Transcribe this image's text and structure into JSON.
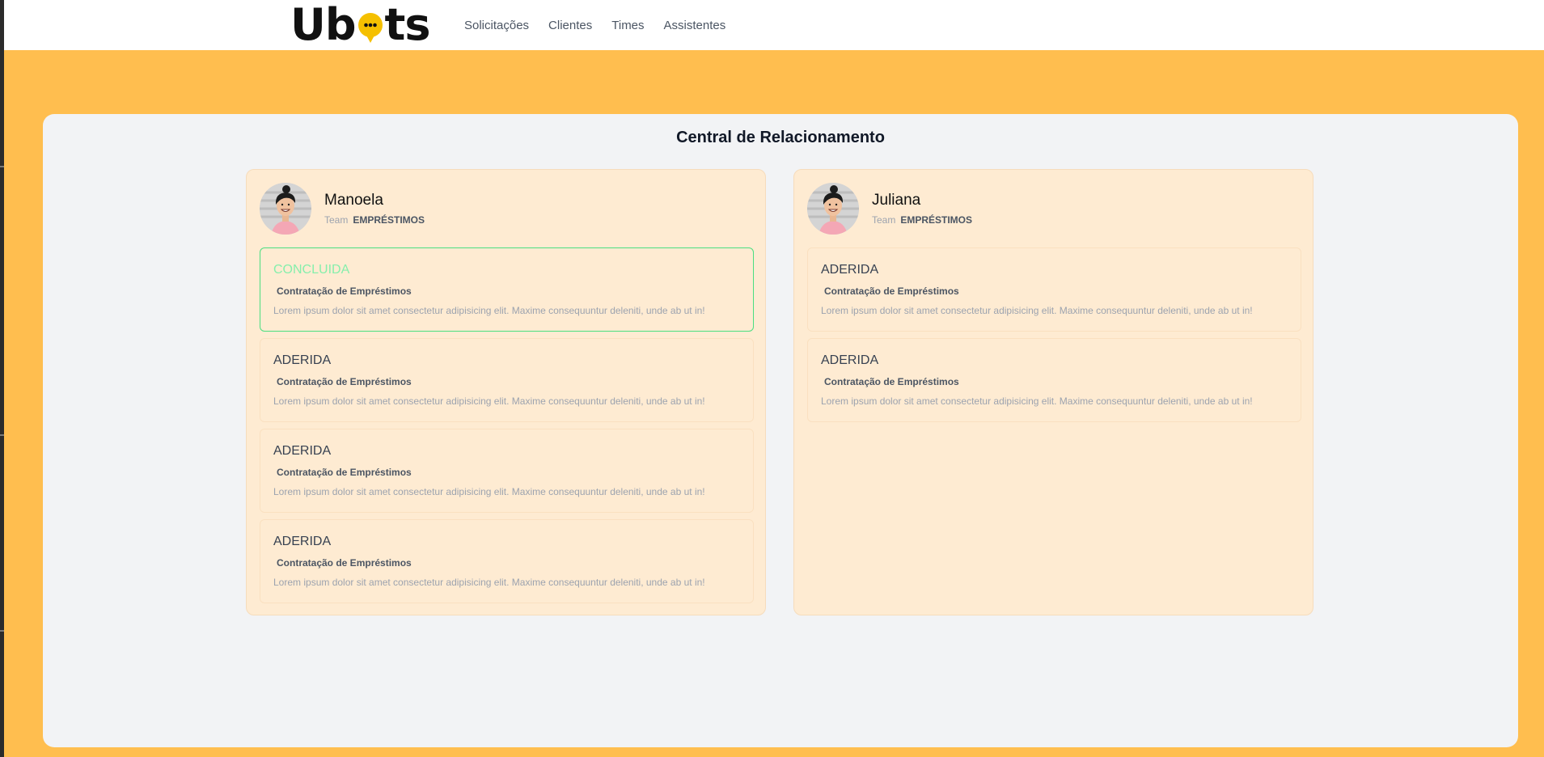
{
  "brand": {
    "logo_text_left": "Ub",
    "logo_text_right": "ts",
    "accent": "#f5c000"
  },
  "nav": [
    {
      "label": "Solicitações"
    },
    {
      "label": "Clientes"
    },
    {
      "label": "Times"
    },
    {
      "label": "Assistentes"
    }
  ],
  "colors": {
    "background": "#ffbe4f",
    "panel": "#f2f3f5",
    "column": "#feebd2",
    "done_border": "#4ade80",
    "done_text": "#86efac"
  },
  "page": {
    "title": "Central de Relacionamento"
  },
  "columns": [
    {
      "name": "Manoela",
      "team_label": "Team",
      "team": "EMPRÉSTIMOS",
      "cards": [
        {
          "status": "CONCLUIDA",
          "title": "Contratação de Empréstimos",
          "desc": "Lorem ipsum dolor sit amet consectetur adipisicing elit. Maxime consequuntur deleniti, unde ab ut in!"
        },
        {
          "status": "ADERIDA",
          "title": "Contratação de Empréstimos",
          "desc": "Lorem ipsum dolor sit amet consectetur adipisicing elit. Maxime consequuntur deleniti, unde ab ut in!"
        },
        {
          "status": "ADERIDA",
          "title": "Contratação de Empréstimos",
          "desc": "Lorem ipsum dolor sit amet consectetur adipisicing elit. Maxime consequuntur deleniti, unde ab ut in!"
        },
        {
          "status": "ADERIDA",
          "title": "Contratação de Empréstimos",
          "desc": "Lorem ipsum dolor sit amet consectetur adipisicing elit. Maxime consequuntur deleniti, unde ab ut in!"
        }
      ]
    },
    {
      "name": "Juliana",
      "team_label": "Team",
      "team": "EMPRÉSTIMOS",
      "cards": [
        {
          "status": "ADERIDA",
          "title": "Contratação de Empréstimos",
          "desc": "Lorem ipsum dolor sit amet consectetur adipisicing elit. Maxime consequuntur deleniti, unde ab ut in!"
        },
        {
          "status": "ADERIDA",
          "title": "Contratação de Empréstimos",
          "desc": "Lorem ipsum dolor sit amet consectetur adipisicing elit. Maxime consequuntur deleniti, unde ab ut in!"
        }
      ]
    }
  ]
}
